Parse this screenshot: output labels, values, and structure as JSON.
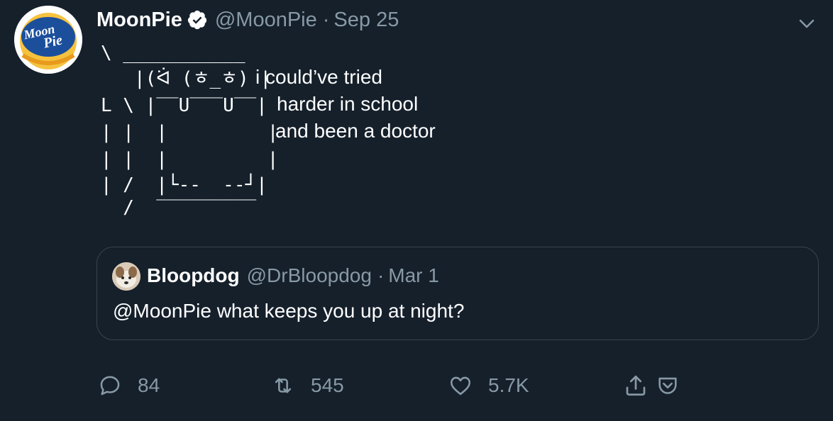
{
  "author": {
    "display_name": "MoonPie",
    "handle": "@MoonPie",
    "separator": "·",
    "time": "Sep 25",
    "avatar": {
      "logo_word_1": "Moon",
      "logo_word_2": "Pie",
      "brand_color": "#1b4f9c",
      "accent_color": "#f6c23e"
    }
  },
  "icons": {
    "verified": "verified-badge-icon",
    "caret": "chevron-down-icon",
    "reply": "reply-bubble-icon",
    "retweet": "retweet-icon",
    "like": "heart-icon",
    "share": "share-upload-icon",
    "pocket": "pocket-icon"
  },
  "body": {
    "art": [
      "\\ ___________",
      "   |(ᐛ (ㅎ_ㅎ) |",
      "L \\ |‾‾U‾‾‾U‾‾|",
      "| |  |         |",
      "| |  |         |",
      "| /  |└--  --┘|",
      "  /  ‾‾‾‾‾‾‾‾‾"
    ],
    "text_lines": [
      "i could’ve tried",
      "harder in school",
      "and been a doctor"
    ]
  },
  "quoted": {
    "display_name": "Bloopdog",
    "handle": "@DrBloopdog",
    "separator": "·",
    "time": "Mar 1",
    "text": "@MoonPie what keeps you up at night?"
  },
  "actions": {
    "reply_count": "84",
    "retweet_count": "545",
    "like_count": "5.7K"
  },
  "colors": {
    "background": "#15202b",
    "secondary_text": "#8899a6",
    "border": "#38444d",
    "primary_text": "#ffffff"
  }
}
